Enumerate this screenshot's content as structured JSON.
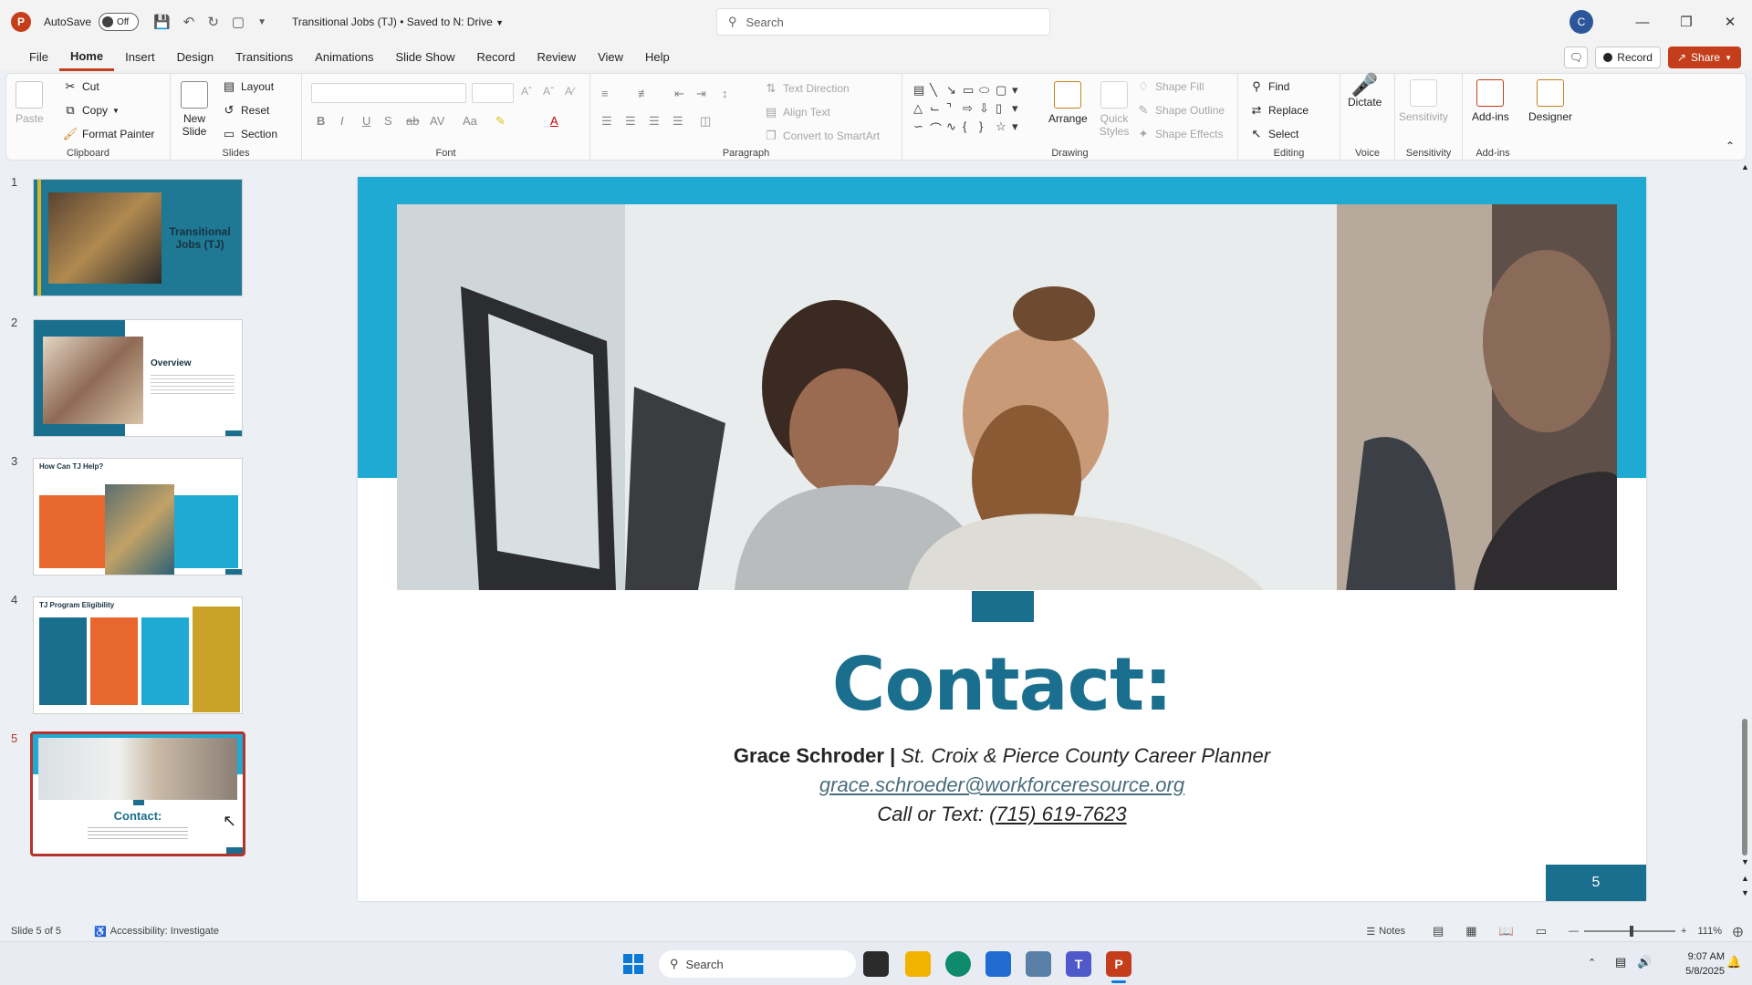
{
  "titlebar": {
    "autosave_label": "AutoSave",
    "autosave_state": "Off",
    "doc_title": "Transitional Jobs (TJ) • Saved to N: Drive",
    "search_placeholder": "Search",
    "account_initial": "C"
  },
  "menu": {
    "tabs": [
      "File",
      "Home",
      "Insert",
      "Design",
      "Transitions",
      "Animations",
      "Slide Show",
      "Record",
      "Review",
      "View",
      "Help"
    ],
    "active": "Home",
    "record_label": "Record",
    "share_label": "Share"
  },
  "ribbon": {
    "clipboard": {
      "label": "Clipboard",
      "paste": "Paste",
      "cut": "Cut",
      "copy": "Copy",
      "format_painter": "Format Painter"
    },
    "slides": {
      "label": "Slides",
      "new_slide": "New Slide",
      "layout": "Layout",
      "reset": "Reset",
      "section": "Section"
    },
    "font": {
      "label": "Font"
    },
    "paragraph": {
      "label": "Paragraph",
      "text_direction": "Text Direction",
      "align_text": "Align Text",
      "convert": "Convert to SmartArt"
    },
    "drawing": {
      "label": "Drawing",
      "arrange": "Arrange",
      "quick_styles": "Quick Styles",
      "shape_fill": "Shape Fill",
      "shape_outline": "Shape Outline",
      "shape_effects": "Shape Effects"
    },
    "editing": {
      "label": "Editing",
      "find": "Find",
      "replace": "Replace",
      "select": "Select"
    },
    "voice": {
      "label": "Voice",
      "dictate": "Dictate"
    },
    "sensitivity": {
      "label": "Sensitivity",
      "button": "Sensitivity"
    },
    "addins": {
      "label": "Add-ins",
      "button": "Add-ins"
    },
    "designer": {
      "button": "Designer"
    }
  },
  "thumbnails": [
    {
      "num": "1",
      "title": "Transitional Jobs (TJ)"
    },
    {
      "num": "2",
      "title": "Overview"
    },
    {
      "num": "3",
      "title": "How Can TJ Help?"
    },
    {
      "num": "4",
      "title": "TJ Program Eligibility"
    },
    {
      "num": "5",
      "title": "Contact:"
    }
  ],
  "slide": {
    "title": "Contact:",
    "name": "Grace Schroder",
    "separator": "|",
    "role": "St. Croix & Pierce County Career Planner",
    "email": "grace.schroeder@workforceresource.org",
    "phone_prefix": "Call or Text:",
    "phone": "(715) 619-7623",
    "page_number": "5",
    "colors": {
      "band": "#1eaad3",
      "accent": "#1b6f8e"
    }
  },
  "status": {
    "slide_of": "Slide 5 of 5",
    "accessibility": "Accessibility: Investigate",
    "notes": "Notes",
    "zoom": "111%"
  },
  "taskbar": {
    "search": "Search",
    "time": "9:07 AM",
    "date": "5/8/2025"
  }
}
